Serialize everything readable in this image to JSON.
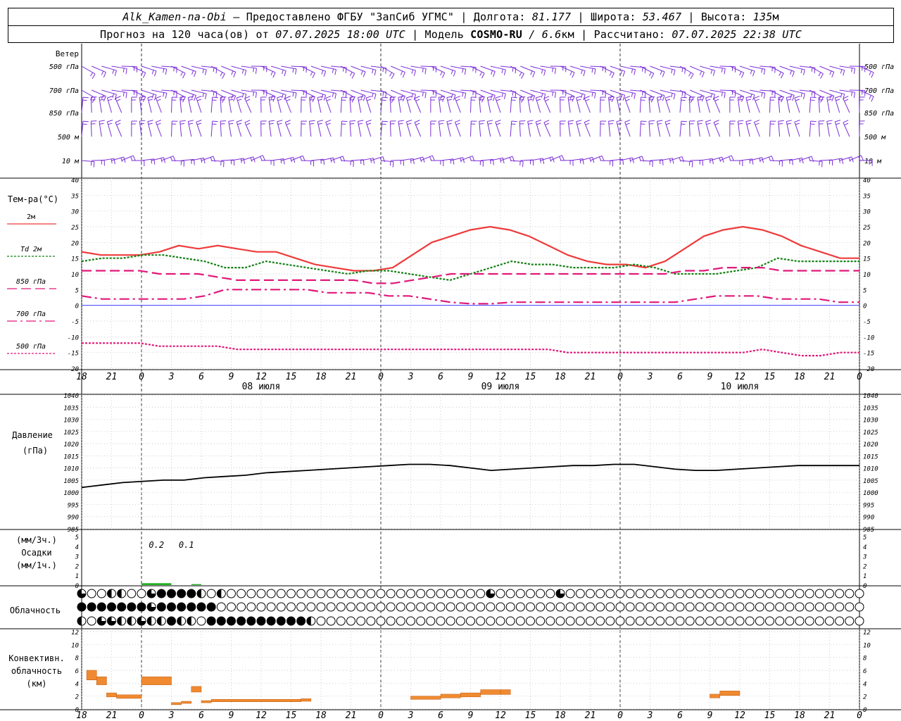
{
  "header": {
    "line1": {
      "station": "Alk_Kamen-na-Obi",
      "provider": " — Предоставлено ФГБУ \"ЗапСиб УГМС\" | Долгота: ",
      "lon": "81.177",
      "lat_label": " | Широта: ",
      "lat": "53.467",
      "alt_label": " | Высота: ",
      "alt": "135",
      "alt_unit": "м"
    },
    "line2": {
      "forecast": "Прогноз на 120 часа(ов) от ",
      "from": "07.07.2025 18:00 UTC",
      "model_label": "  | Модель ",
      "model": "COSMO-RU",
      "res": " / 6.6",
      "res_unit": "км",
      "calc_label": " | Рассчитано: ",
      "calc": "07.07.2025 22:38 UTC"
    }
  },
  "chart_data": {
    "type": "line",
    "time_axis": {
      "hour_ticks": [
        "18",
        "21",
        "0",
        "3",
        "6",
        "9",
        "12",
        "15",
        "18",
        "21",
        "0",
        "3",
        "6",
        "9",
        "12",
        "15",
        "18",
        "21",
        "0",
        "3",
        "6",
        "9",
        "12",
        "15",
        "18",
        "21",
        "0"
      ],
      "dates": [
        "08 июля",
        "09 июля",
        "10 июля"
      ]
    },
    "wind": {
      "title": "Ветер",
      "levels": [
        "500 гПа",
        "700 гПа",
        "850 гПа",
        "500 м",
        "10 м"
      ]
    },
    "temperature": {
      "ylabel": "Тем-ра(°C)",
      "ylim": [
        -20,
        40
      ],
      "yticks": [
        "40",
        "35",
        "30",
        "25",
        "20",
        "15",
        "10",
        "5",
        "0",
        "-5",
        "-10",
        "-15",
        "-20"
      ],
      "series": [
        {
          "name": "2м",
          "color": "#ee3b3b",
          "style": "solid",
          "x": [
            0,
            2,
            4,
            6,
            8,
            10,
            12,
            14,
            16,
            18,
            20,
            22,
            24,
            26,
            28,
            30,
            32,
            34,
            36,
            38,
            40,
            42,
            44,
            46,
            48,
            50,
            52,
            54,
            56,
            58,
            60,
            62,
            64,
            66,
            68,
            70,
            72,
            74,
            76,
            78,
            80,
            82,
            84,
            86,
            88,
            90,
            92,
            94,
            96,
            98,
            100,
            102,
            104,
            106,
            108,
            110,
            112,
            114,
            116,
            118,
            120
          ],
          "y": [
            17,
            16,
            16,
            16,
            17,
            19,
            18,
            19,
            18,
            17,
            17,
            15,
            13,
            12,
            11,
            11,
            12,
            16,
            20,
            22,
            24,
            25,
            24,
            22,
            19,
            16,
            14,
            13,
            13,
            12,
            14,
            18,
            22,
            24,
            25,
            24,
            22,
            19,
            17,
            15,
            15
          ]
        },
        {
          "name": "Td 2м",
          "color": "#158015",
          "style": "dotted",
          "y": [
            14,
            15,
            15,
            16,
            16,
            15,
            14,
            12,
            12,
            14,
            13,
            12,
            11,
            10,
            11,
            11,
            10,
            9,
            8,
            10,
            12,
            14,
            13,
            13,
            12,
            12,
            12,
            13,
            12,
            10,
            10,
            10,
            11,
            12,
            15,
            14,
            14,
            14,
            14
          ]
        },
        {
          "name": "850 гПа",
          "color": "#e0187a",
          "style": "dashed",
          "y": [
            11,
            11,
            11,
            11,
            10,
            10,
            10,
            9,
            8,
            8,
            8,
            8,
            8,
            8,
            8,
            7,
            7,
            8,
            9,
            10,
            10,
            10,
            10,
            10,
            10,
            10,
            10,
            10,
            10,
            10,
            10,
            11,
            11,
            12,
            12,
            12,
            11,
            11,
            11,
            11,
            11
          ]
        },
        {
          "name": "700 гПа",
          "color": "#e0187a",
          "style": "dashdot",
          "y": [
            3,
            2,
            2,
            2,
            2,
            2,
            3,
            5,
            5,
            5,
            5,
            5,
            4,
            4,
            4,
            3,
            3,
            2,
            1,
            0.5,
            0.5,
            1,
            1,
            1,
            1,
            1,
            1,
            1,
            1,
            1,
            2,
            3,
            3,
            3,
            2,
            2,
            2,
            1,
            1
          ]
        },
        {
          "name": "500 гПа",
          "color": "#e0187a",
          "style": "dotted",
          "y": [
            -12,
            -12,
            -12,
            -12,
            -13,
            -13,
            -13,
            -13,
            -14,
            -14,
            -14,
            -14,
            -14,
            -14,
            -14,
            -14,
            -14,
            -14,
            -14,
            -14,
            -14,
            -14,
            -14,
            -14,
            -14,
            -15,
            -15,
            -15,
            -15,
            -15,
            -15,
            -15,
            -15,
            -15,
            -15,
            -14,
            -15,
            -16,
            -16,
            -15,
            -15
          ]
        }
      ]
    },
    "pressure": {
      "ylabel": "Давление",
      "unit": "(гПа)",
      "ylim": [
        985,
        1040
      ],
      "yticks": [
        "1040",
        "1035",
        "1030",
        "1025",
        "1020",
        "1015",
        "1010",
        "1005",
        "1000",
        "995",
        "990",
        "985"
      ],
      "y": [
        1002,
        1003,
        1004,
        1004.5,
        1005,
        1005,
        1006,
        1006.5,
        1007,
        1008,
        1008.5,
        1009,
        1009.5,
        1010,
        1010.5,
        1011,
        1011.5,
        1011.5,
        1011,
        1010,
        1009,
        1009.5,
        1010,
        1010.5,
        1011,
        1011,
        1011.5,
        1011.5,
        1010.5,
        1009.5,
        1009,
        1009,
        1009.5,
        1010,
        1010.5,
        1011,
        1011,
        1011,
        1011
      ]
    },
    "precip": {
      "labels": [
        "(мм/3ч.)",
        "Осадки",
        "(мм/1ч.)"
      ],
      "ylim": [
        0,
        5
      ],
      "yticks": [
        "5",
        "4",
        "3",
        "2",
        "1",
        "0"
      ],
      "annotations": [
        {
          "hour": 7.5,
          "text": "0.2"
        },
        {
          "hour": 10.5,
          "text": "0.1"
        }
      ],
      "bars": [
        {
          "from": 6,
          "to": 9,
          "value": 0.2
        },
        {
          "from": 11,
          "to": 12,
          "value": 0.1
        }
      ]
    },
    "clouds": {
      "label": "Облачность",
      "rows": [
        [
          3,
          0,
          0,
          2,
          2,
          0,
          0,
          3,
          4,
          4,
          4,
          4,
          2,
          0,
          2,
          0,
          0,
          0,
          0,
          0,
          0,
          0,
          0,
          0,
          0,
          0,
          0,
          0,
          0,
          0,
          0,
          0,
          0,
          0,
          0,
          0,
          0,
          0,
          0,
          0,
          0,
          3,
          0,
          0,
          0,
          0,
          0,
          0,
          3,
          0,
          0,
          0,
          0,
          0,
          0,
          0,
          0,
          0,
          0,
          0,
          0,
          0,
          0,
          0,
          0,
          0,
          0,
          0,
          0,
          0,
          0,
          0,
          0,
          0,
          0,
          0,
          0,
          0,
          0,
          0,
          0,
          0,
          0,
          0,
          0,
          0,
          0,
          0,
          0,
          0,
          0,
          0,
          0,
          0,
          0,
          0,
          0,
          0,
          0,
          0,
          0,
          0,
          0,
          0,
          0,
          0,
          0,
          0,
          0,
          0,
          0,
          0,
          0,
          0,
          0,
          0,
          0,
          0,
          0,
          0,
          4
        ],
        [
          4,
          4,
          4,
          4,
          4,
          4,
          4,
          3,
          4,
          4,
          4,
          4,
          4,
          4,
          0,
          0,
          0,
          0,
          0,
          0,
          0,
          0,
          0,
          0,
          0,
          0,
          0,
          0,
          0,
          0,
          0,
          0,
          0,
          0,
          0,
          0,
          0,
          0,
          0,
          0,
          0,
          0,
          0,
          0,
          0,
          0,
          0,
          0,
          0,
          0,
          0,
          0,
          0,
          0,
          0,
          0,
          0,
          0,
          0,
          0,
          0,
          0,
          0,
          0,
          0,
          0,
          0,
          0,
          0,
          0,
          0,
          0,
          0,
          0,
          0,
          0,
          0,
          0,
          0,
          0,
          0,
          0,
          0,
          0,
          0,
          0,
          0,
          0,
          0,
          0,
          0,
          0,
          0,
          0,
          0,
          0,
          0,
          0,
          0,
          0,
          0,
          0,
          0,
          0,
          0,
          0,
          0,
          0,
          0,
          0,
          0,
          0,
          0,
          0,
          0,
          0,
          0,
          0,
          0,
          0,
          0
        ],
        [
          2,
          0,
          3,
          3,
          2,
          2,
          3,
          2,
          2,
          4,
          2,
          2,
          0,
          4,
          4,
          4,
          4,
          4,
          4,
          4,
          4,
          4,
          4,
          2,
          0,
          0,
          0,
          0,
          0,
          0,
          0,
          0,
          0,
          0,
          0,
          0,
          0,
          0,
          0,
          0,
          0,
          0,
          0,
          0,
          0,
          0,
          0,
          0,
          0,
          0,
          0,
          0,
          0,
          0,
          0,
          0,
          0,
          0,
          0,
          0,
          0,
          0,
          0,
          0,
          0,
          0,
          0,
          0,
          0,
          0,
          0,
          0,
          0,
          0,
          0,
          0,
          0,
          0,
          0,
          0,
          0,
          0,
          0,
          0,
          0,
          0,
          0,
          0,
          0,
          0,
          0,
          0,
          0,
          0,
          0,
          0,
          0,
          0,
          0,
          0,
          0,
          0,
          0,
          0,
          0,
          0,
          0,
          0,
          0,
          0,
          0,
          0,
          0,
          0,
          0,
          0,
          0,
          0,
          0,
          0,
          0
        ]
      ]
    },
    "convective": {
      "labels": [
        "Конвективн.",
        "облачность",
        "(км)"
      ],
      "ylim": [
        0,
        12
      ],
      "yticks": [
        "12",
        "10",
        "8",
        "6",
        "4",
        "2",
        "0"
      ],
      "bars": [
        {
          "from": 0.5,
          "to": 1.5,
          "value": 6
        },
        {
          "from": 1.5,
          "to": 2.5,
          "value": 5
        },
        {
          "from": 2.5,
          "to": 3.5,
          "value": 2.5
        },
        {
          "from": 3.5,
          "to": 6,
          "value": 2.2
        },
        {
          "from": 6,
          "to": 9,
          "value": 5
        },
        {
          "from": 9,
          "to": 10,
          "value": 1
        },
        {
          "from": 10,
          "to": 11,
          "value": 1.2
        },
        {
          "from": 11,
          "to": 12,
          "value": 3.5
        },
        {
          "from": 12,
          "to": 13,
          "value": 1.3
        },
        {
          "from": 13,
          "to": 22,
          "value": 1.5
        },
        {
          "from": 22,
          "to": 23,
          "value": 1.6
        },
        {
          "from": 33,
          "to": 36,
          "value": 2
        },
        {
          "from": 36,
          "to": 38,
          "value": 2.3
        },
        {
          "from": 38,
          "to": 40,
          "value": 2.5
        },
        {
          "from": 40,
          "to": 42,
          "value": 3
        },
        {
          "from": 42,
          "to": 43,
          "value": 3
        },
        {
          "from": 63,
          "to": 64,
          "value": 2.3
        },
        {
          "from": 64,
          "to": 66,
          "value": 2.8
        }
      ]
    }
  }
}
